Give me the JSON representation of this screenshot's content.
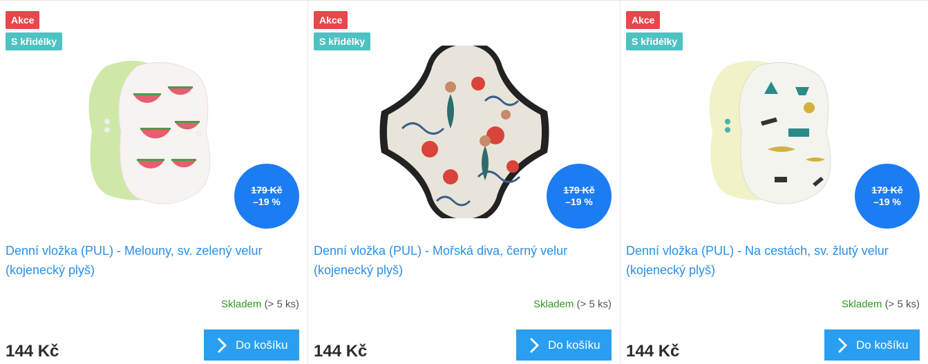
{
  "products": [
    {
      "flag_sale": "Akce",
      "flag_wings": "S křidélky",
      "old_price": "179 Kč",
      "discount": "–19 %",
      "name": "Denní vložka (PUL) - Melouny, sv. zelený velur (kojenecký plyš)",
      "stock_status": "Skladem",
      "stock_qty": "(> 5 ks)",
      "price": "144 Kč",
      "button_label": "Do košíku",
      "image_colors": {
        "back": "#cfe8a8",
        "front": "#f7f3f1",
        "accent": "#e45f6f"
      }
    },
    {
      "flag_sale": "Akce",
      "flag_wings": "S křidélky",
      "old_price": "179 Kč",
      "discount": "–19 %",
      "name": "Denní vložka (PUL) - Mořská diva, černý velur (kojenecký plyš)",
      "stock_status": "Skladem",
      "stock_qty": "(> 5 ks)",
      "price": "144 Kč",
      "button_label": "Do košíku",
      "image_colors": {
        "back": "#222222",
        "front": "#e9e4da",
        "accent": "#d9443a"
      }
    },
    {
      "flag_sale": "Akce",
      "flag_wings": "S křidélky",
      "old_price": "179 Kč",
      "discount": "–19 %",
      "name": "Denní vložka (PUL) - Na cestách, sv. žlutý velur (kojenecký plyš)",
      "stock_status": "Skladem",
      "stock_qty": "(> 5 ks)",
      "price": "144 Kč",
      "button_label": "Do košíku",
      "image_colors": {
        "back": "#f1f2c8",
        "front": "#f4f4ee",
        "accent": "#2a8a8a"
      }
    }
  ],
  "colors": {
    "sale_flag": "#e8474b",
    "wings_flag": "#4ec2c2",
    "discount_badge": "#1c7cf2",
    "button": "#2a9ef0",
    "link": "#2c8ee3",
    "in_stock": "#2e9a1f"
  }
}
